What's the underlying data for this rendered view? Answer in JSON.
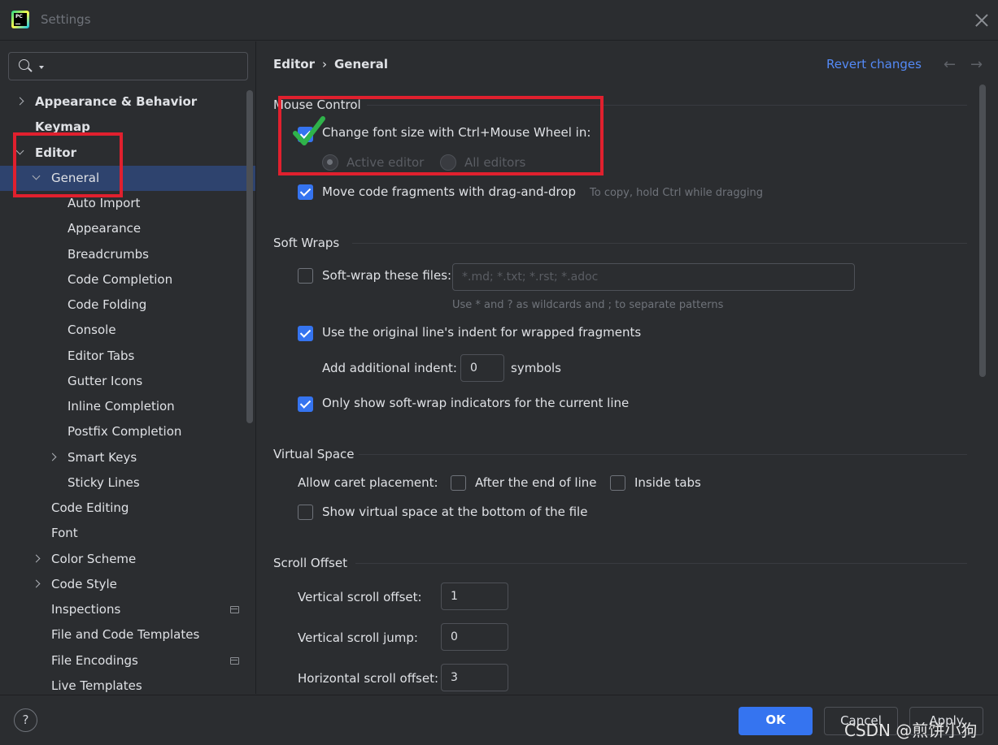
{
  "window": {
    "title": "Settings"
  },
  "search": {
    "placeholder": "",
    "value": ""
  },
  "sidebar": {
    "items": [
      {
        "label": "Appearance & Behavior",
        "chevron": "right",
        "bold": true
      },
      {
        "label": "Keymap",
        "chevron": "",
        "bold": true
      },
      {
        "label": "Editor",
        "chevron": "down",
        "bold": true
      },
      {
        "label": "General",
        "chevron": "down",
        "selected": true
      },
      {
        "label": "Auto Import"
      },
      {
        "label": "Appearance"
      },
      {
        "label": "Breadcrumbs"
      },
      {
        "label": "Code Completion"
      },
      {
        "label": "Code Folding"
      },
      {
        "label": "Console"
      },
      {
        "label": "Editor Tabs"
      },
      {
        "label": "Gutter Icons"
      },
      {
        "label": "Inline Completion"
      },
      {
        "label": "Postfix Completion"
      },
      {
        "label": "Smart Keys",
        "chevron": "right"
      },
      {
        "label": "Sticky Lines"
      },
      {
        "label": "Code Editing"
      },
      {
        "label": "Font"
      },
      {
        "label": "Color Scheme",
        "chevron": "right"
      },
      {
        "label": "Code Style",
        "chevron": "right"
      },
      {
        "label": "Inspections",
        "badge": true
      },
      {
        "label": "File and Code Templates"
      },
      {
        "label": "File Encodings",
        "badge": true
      },
      {
        "label": "Live Templates"
      }
    ]
  },
  "header": {
    "breadcrumb": [
      "Editor",
      "General"
    ],
    "separator": "›",
    "revert": "Revert changes",
    "back_icon": "←",
    "forward_icon": "→"
  },
  "mouse_control": {
    "title": "Mouse Control",
    "font_size_ctrl_wheel": {
      "label": "Change font size with Ctrl+Mouse Wheel in:",
      "checked": true
    },
    "radio_active": {
      "label": "Active editor",
      "selected": true
    },
    "radio_all": {
      "label": "All editors",
      "selected": false
    },
    "drag_drop": {
      "label": "Move code fragments with drag-and-drop",
      "checked": true,
      "hint": "To copy, hold Ctrl while dragging"
    }
  },
  "soft_wraps": {
    "title": "Soft Wraps",
    "soft_wrap_files": {
      "label": "Soft-wrap these files:",
      "checked": false,
      "placeholder": "*.md; *.txt; *.rst; *.adoc",
      "hint": "Use * and ? as wildcards and ; to separate patterns"
    },
    "original_indent": {
      "label": "Use the original line's indent for wrapped fragments",
      "checked": true
    },
    "additional_indent": {
      "label": "Add additional indent:",
      "value": "0",
      "unit": "symbols"
    },
    "indicators_current": {
      "label": "Only show soft-wrap indicators for the current line",
      "checked": true
    }
  },
  "virtual_space": {
    "title": "Virtual Space",
    "caret_label": "Allow caret placement:",
    "after_end": {
      "label": "After the end of line",
      "checked": false
    },
    "inside_tabs": {
      "label": "Inside tabs",
      "checked": false
    },
    "show_bottom": {
      "label": "Show virtual space at the bottom of the file",
      "checked": false
    }
  },
  "scroll_offset": {
    "title": "Scroll Offset",
    "vertical_offset": {
      "label": "Vertical scroll offset:",
      "value": "1"
    },
    "vertical_jump": {
      "label": "Vertical scroll jump:",
      "value": "0"
    },
    "horizontal_offset": {
      "label": "Horizontal scroll offset:",
      "value": "3"
    }
  },
  "footer": {
    "help": "?",
    "ok": "OK",
    "cancel": "Cancel",
    "apply": "Apply"
  },
  "watermark": "CSDN @煎饼小狗",
  "colors": {
    "accent": "#3574f0",
    "link": "#548af7",
    "annotation_red": "#e0202e",
    "annotation_green": "#2fb34a"
  }
}
